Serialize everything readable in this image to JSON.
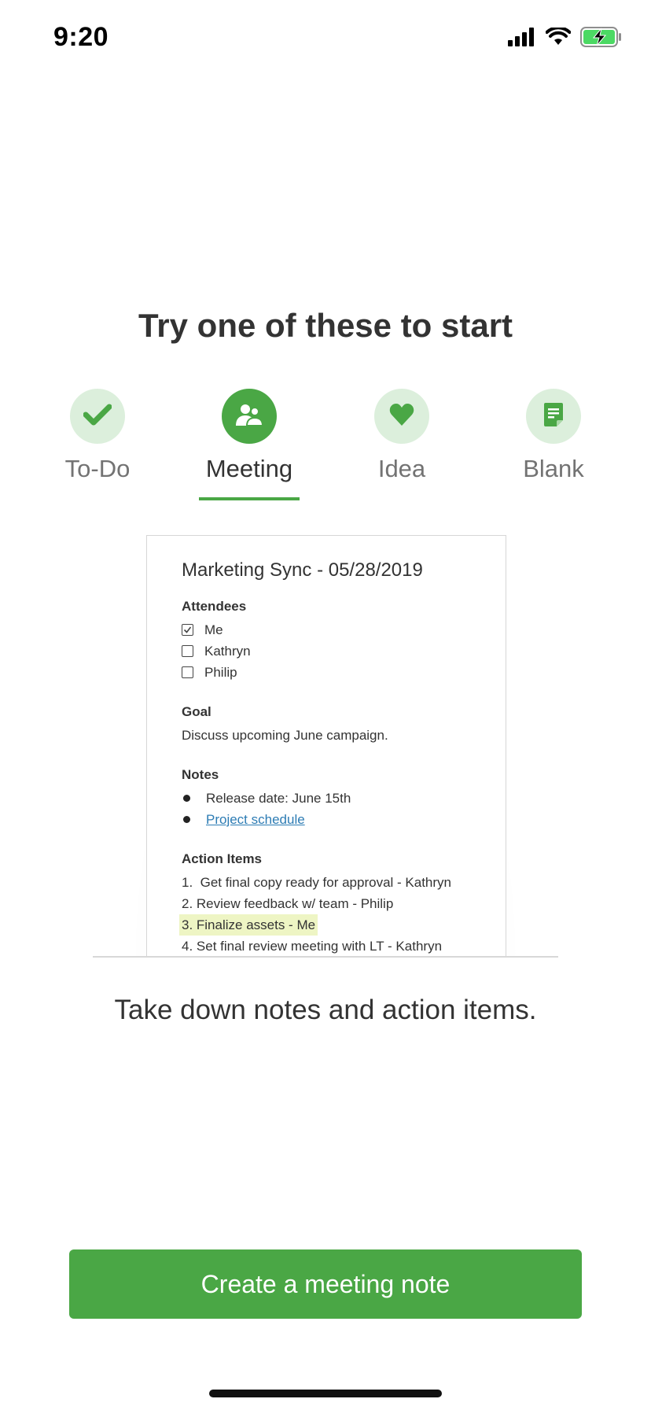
{
  "status_bar": {
    "time": "9:20",
    "icons": [
      "signal-icon",
      "wifi-icon",
      "battery-charging-icon"
    ]
  },
  "title": "Try one of these to start",
  "templates": [
    {
      "label": "To-Do",
      "icon": "checkmark-icon",
      "selected": false
    },
    {
      "label": "Meeting",
      "icon": "people-icon",
      "selected": true
    },
    {
      "label": "Idea",
      "icon": "heart-icon",
      "selected": false
    },
    {
      "label": "Blank",
      "icon": "document-icon",
      "selected": false
    }
  ],
  "preview": {
    "note_title": "Marketing Sync - 05/28/2019",
    "attendees_heading": "Attendees",
    "attendees": [
      {
        "name": "Me",
        "checked": true
      },
      {
        "name": "Kathryn",
        "checked": false
      },
      {
        "name": "Philip",
        "checked": false
      }
    ],
    "goal_heading": "Goal",
    "goal_text": "Discuss upcoming June campaign.",
    "notes_heading": "Notes",
    "notes": [
      {
        "text": "Release date: June 15th",
        "link": false
      },
      {
        "text": "Project schedule",
        "link": true
      }
    ],
    "action_heading": "Action Items",
    "actions": [
      {
        "text": "1.  Get final copy ready for approval - Kathryn",
        "highlighted": false
      },
      {
        "text": "2. Review feedback w/ team - Philip",
        "highlighted": false
      },
      {
        "text": "3. Finalize assets - Me",
        "highlighted": true
      },
      {
        "text": "4. Set final review meeting with LT - Kathryn",
        "highlighted": false
      }
    ]
  },
  "caption": "Take down notes and action items.",
  "cta_label": "Create a meeting note",
  "colors": {
    "accent": "#4aa745",
    "accent_light": "#dcefdc",
    "link": "#2d7cb4",
    "highlight": "#eef5c4"
  }
}
